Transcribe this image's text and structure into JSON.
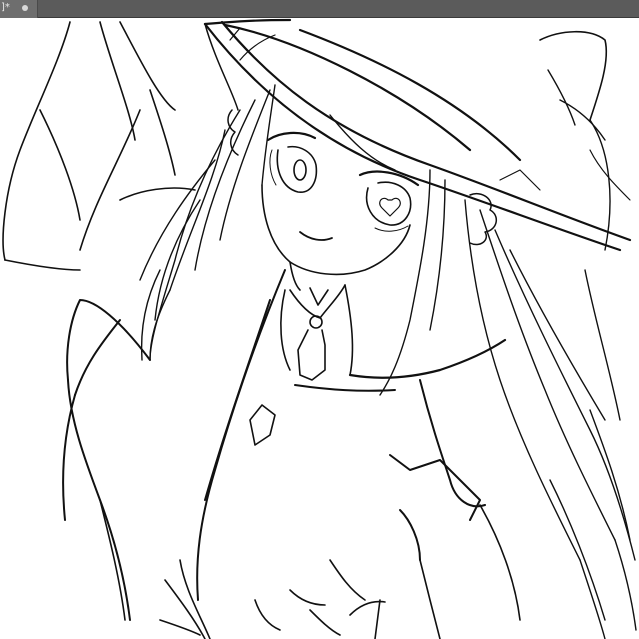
{
  "tab": {
    "label": "]*",
    "modified_dot": "unsaved-indicator"
  },
  "colors": {
    "tabbar_bg": "#5b5b5b",
    "tab_bg": "#6e6e6e",
    "canvas_bg": "#ffffff",
    "ink": "#111111"
  },
  "canvas": {
    "content": "line-art-sketch"
  }
}
